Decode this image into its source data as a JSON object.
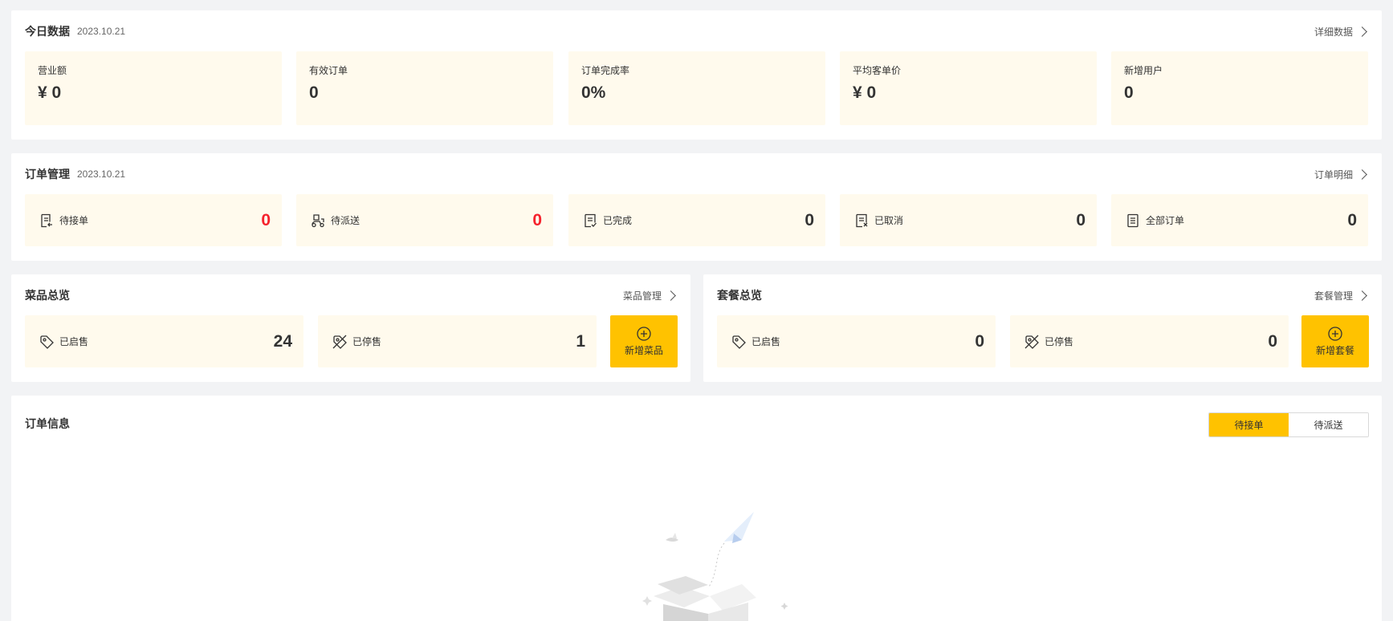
{
  "today": {
    "title": "今日数据",
    "date": "2023.10.21",
    "link": "详细数据",
    "stats": [
      {
        "label": "营业额",
        "value": "¥ 0"
      },
      {
        "label": "有效订单",
        "value": "0"
      },
      {
        "label": "订单完成率",
        "value": "0%"
      },
      {
        "label": "平均客单价",
        "value": "¥ 0"
      },
      {
        "label": "新增用户",
        "value": "0"
      }
    ]
  },
  "orders": {
    "title": "订单管理",
    "date": "2023.10.21",
    "link": "订单明细",
    "items": [
      {
        "label": "待接单",
        "value": "0",
        "icon": "pending-order-icon",
        "highlight": true
      },
      {
        "label": "待派送",
        "value": "0",
        "icon": "delivery-icon",
        "highlight": true
      },
      {
        "label": "已完成",
        "value": "0",
        "icon": "completed-order-icon",
        "highlight": false
      },
      {
        "label": "已取消",
        "value": "0",
        "icon": "cancelled-order-icon",
        "highlight": false
      },
      {
        "label": "全部订单",
        "value": "0",
        "icon": "all-orders-icon",
        "highlight": false
      }
    ]
  },
  "dishes": {
    "title": "菜品总览",
    "link": "菜品管理",
    "on_sale": {
      "label": "已启售",
      "value": "24"
    },
    "off_sale": {
      "label": "已停售",
      "value": "1"
    },
    "add_label": "新增菜品"
  },
  "setmeals": {
    "title": "套餐总览",
    "link": "套餐管理",
    "on_sale": {
      "label": "已启售",
      "value": "0"
    },
    "off_sale": {
      "label": "已停售",
      "value": "0"
    },
    "add_label": "新增套餐"
  },
  "order_info": {
    "title": "订单信息",
    "tabs": [
      "待接单",
      "待派送"
    ],
    "active_tab": 0
  },
  "colors": {
    "accent": "#ffc200",
    "tile_bg": "#fffaed",
    "alert": "#f5222d"
  }
}
